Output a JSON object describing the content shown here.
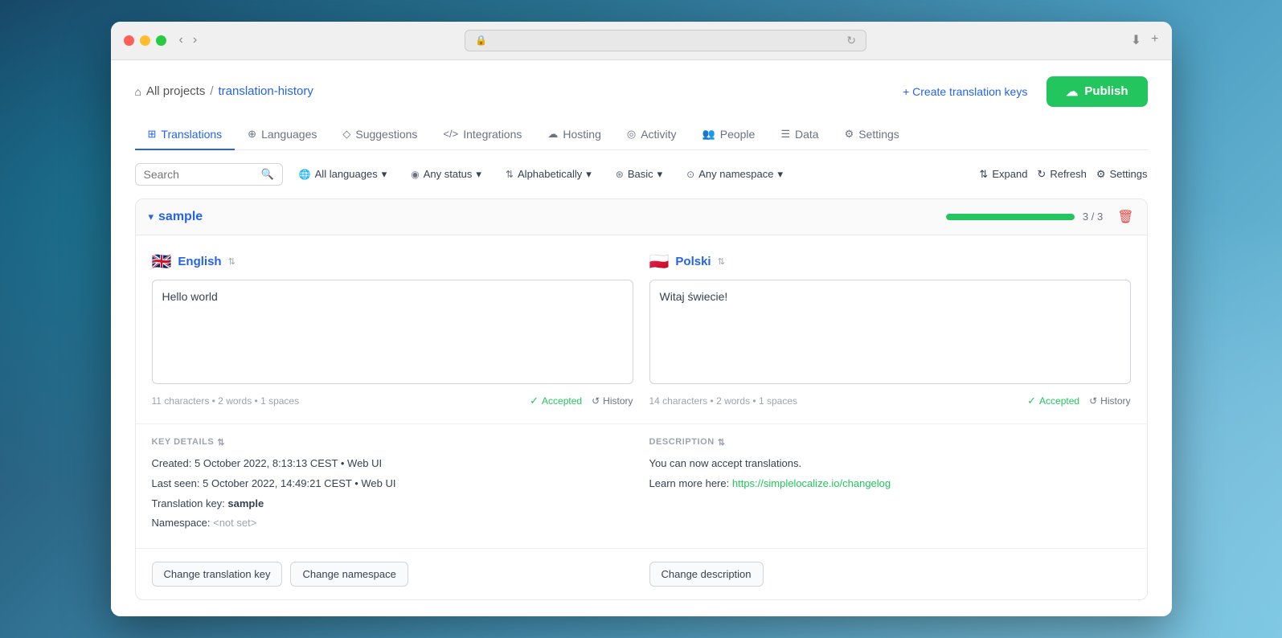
{
  "browser": {
    "url": "",
    "traffic_lights": [
      "red",
      "yellow",
      "green"
    ]
  },
  "breadcrumb": {
    "home_icon": "⌂",
    "all_projects": "All projects",
    "separator": "/",
    "current_project": "translation-history"
  },
  "header": {
    "create_keys_label": "+ Create translation keys",
    "publish_label": "Publish",
    "publish_icon": "☁"
  },
  "nav_tabs": [
    {
      "id": "translations",
      "icon": "⊞",
      "label": "Translations",
      "active": true
    },
    {
      "id": "languages",
      "icon": "⊕",
      "label": "Languages",
      "active": false
    },
    {
      "id": "suggestions",
      "icon": "◇",
      "label": "Suggestions",
      "active": false
    },
    {
      "id": "integrations",
      "icon": "</>",
      "label": "Integrations",
      "active": false
    },
    {
      "id": "hosting",
      "icon": "☁",
      "label": "Hosting",
      "active": false
    },
    {
      "id": "activity",
      "icon": "◎",
      "label": "Activity",
      "active": false
    },
    {
      "id": "people",
      "icon": "👥",
      "label": "People",
      "active": false
    },
    {
      "id": "data",
      "icon": "☰",
      "label": "Data",
      "active": false
    },
    {
      "id": "settings",
      "icon": "⚙",
      "label": "Settings",
      "active": false
    }
  ],
  "filters": {
    "search_placeholder": "Search",
    "all_languages": "All languages",
    "any_status": "Any status",
    "alphabetically": "Alphabetically",
    "basic": "Basic",
    "any_namespace": "Any namespace",
    "expand": "Expand",
    "refresh": "Refresh",
    "settings": "Settings"
  },
  "section": {
    "name": "sample",
    "progress_filled_pct": 100,
    "progress_label": "3 / 3"
  },
  "english": {
    "flag": "🇬🇧",
    "language": "English",
    "translation": "Hello world",
    "stats": "11 characters • 2 words • 1 spaces",
    "accepted_label": "Accepted",
    "history_label": "History"
  },
  "polish": {
    "flag": "🇵🇱",
    "language": "Polski",
    "translation": "Witaj świecie!",
    "stats": "14 characters • 2 words • 1 spaces",
    "accepted_label": "Accepted",
    "history_label": "History"
  },
  "key_details": {
    "title": "KEY DETAILS",
    "created_label": "Created:",
    "created_value": "5 October 2022, 8:13:13 CEST • Web UI",
    "last_seen_label": "Last seen:",
    "last_seen_value": "5 October 2022, 14:49:21 CEST • Web UI",
    "translation_key_label": "Translation key:",
    "translation_key_value": "sample",
    "namespace_label": "Namespace:",
    "namespace_value": "<not set>"
  },
  "description": {
    "title": "DESCRIPTION",
    "text1": "You can now accept translations.",
    "text2": "Learn more here:",
    "link_text": "https://simplelocalize.io/changelog",
    "link_url": "https://simplelocalize.io/changelog"
  },
  "action_buttons": {
    "change_key": "Change translation key",
    "change_namespace": "Change namespace",
    "change_description": "Change description"
  }
}
